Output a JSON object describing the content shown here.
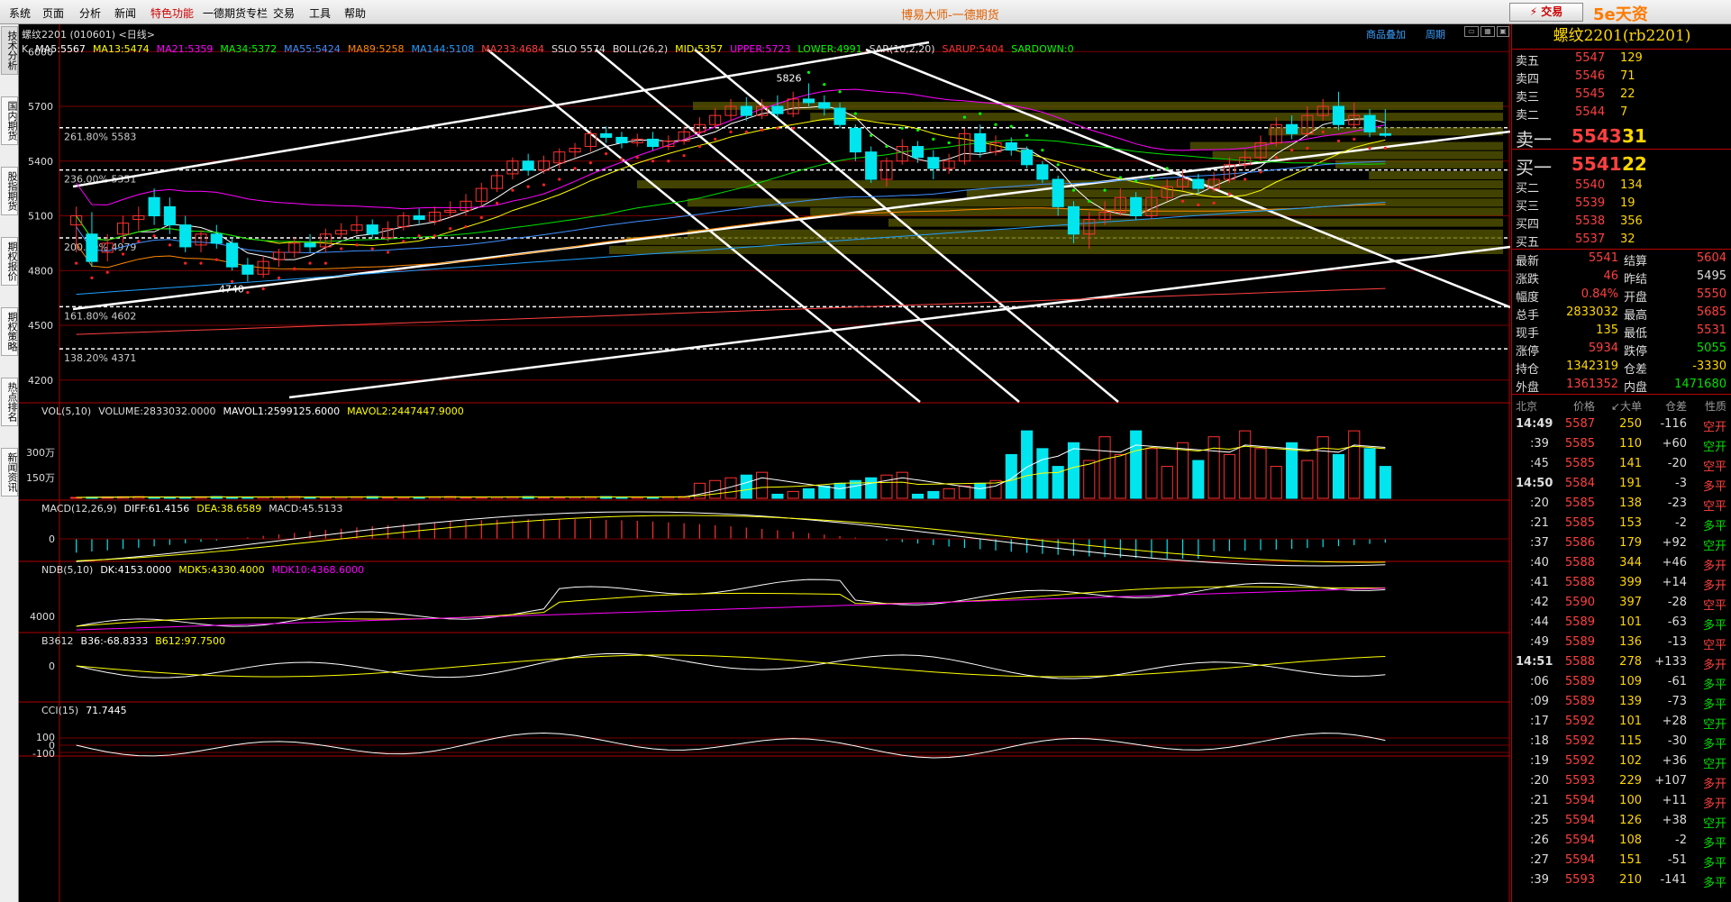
{
  "menu": [
    "系统",
    "页面",
    "分析",
    "新闻",
    "特色功能",
    "一德期货专栏",
    "交易",
    "工具",
    "帮助"
  ],
  "menu_red_index": 4,
  "app_title": "博易大师-一德期货",
  "trade_button": "⚡ 交易",
  "watermark": "5e天资5etz.com",
  "side_tabs": [
    "技术分析",
    "国内期货",
    "股指期货",
    "期权报价",
    "期权策略",
    "热点排名",
    "新闻资讯"
  ],
  "header": {
    "symbol_line": "螺纹2201 (010601) <日线>",
    "link_overlay": "商品叠加",
    "link_period": "周期",
    "k_label": "K",
    "indicators": [
      {
        "text": "MA5:5567",
        "color": "#ffffff"
      },
      {
        "text": "MA13:5474",
        "color": "#ffff00"
      },
      {
        "text": "MA21:5359",
        "color": "#ff00ff"
      },
      {
        "text": "MA34:5372",
        "color": "#00ff00"
      },
      {
        "text": "MA55:5424",
        "color": "#4090ff"
      },
      {
        "text": "MA89:5258",
        "color": "#ff8800"
      },
      {
        "text": "MA144:5108",
        "color": "#20a0ff"
      },
      {
        "text": "MA233:4684",
        "color": "#ff4040"
      },
      {
        "text": "SSLO 5574",
        "color": "#dddddd"
      },
      {
        "text": "BOLL(26,2)",
        "color": "#dddddd"
      },
      {
        "text": "MID:5357",
        "color": "#ffff00"
      },
      {
        "text": "UPPER:5723",
        "color": "#ff00ff"
      },
      {
        "text": "LOWER:4991",
        "color": "#00ff00"
      },
      {
        "text": "SAR(10,2,20)",
        "color": "#dddddd"
      },
      {
        "text": "SARUP:5404",
        "color": "#ff3030"
      },
      {
        "text": "SARDOWN:0",
        "color": "#00ff00"
      }
    ]
  },
  "price_axis": [
    "6000",
    "5700",
    "5400",
    "5100",
    "4800",
    "4500",
    "4200"
  ],
  "fib_labels": [
    "261.80% 5583",
    "236.00% 5351",
    "200.00% 4979",
    "161.80% 4602",
    "138.20% 4371"
  ],
  "price_marks": {
    "high": "5826",
    "low": "4740"
  },
  "volume_panel": {
    "title": "VOL(5,10)",
    "items": [
      {
        "text": "VOLUME:2833032.0000",
        "color": "#dddddd"
      },
      {
        "text": "MAVOL1:2599125.6000",
        "color": "#ffffff"
      },
      {
        "text": "MAVOL2:2447447.9000",
        "color": "#ffff00"
      }
    ],
    "axis": [
      "300万",
      "150万"
    ]
  },
  "macd_panel": {
    "title": "MACD(12,26,9)",
    "items": [
      {
        "text": "DIFF:61.4156",
        "color": "#ffffff"
      },
      {
        "text": "DEA:38.6589",
        "color": "#ffff00"
      },
      {
        "text": "MACD:45.5133",
        "color": "#dddddd"
      }
    ],
    "axis": [
      "0"
    ]
  },
  "ndb_panel": {
    "title": "NDB(5,10)",
    "items": [
      {
        "text": "DK:4153.0000",
        "color": "#ffffff"
      },
      {
        "text": "MDK5:4330.4000",
        "color": "#ffff00"
      },
      {
        "text": "MDK10:4368.6000",
        "color": "#ff00ff"
      }
    ],
    "axis": [
      "4000"
    ]
  },
  "b3612_panel": {
    "title": "B3612",
    "items": [
      {
        "text": "B36:-68.8333",
        "color": "#ffffff"
      },
      {
        "text": "B612:97.7500",
        "color": "#ffff00"
      }
    ],
    "axis": [
      "0"
    ]
  },
  "cci_panel": {
    "title": "CCI(15)",
    "items": [
      {
        "text": "71.7445",
        "color": "#ffffff"
      }
    ],
    "axis": [
      "100",
      "0",
      "-100"
    ]
  },
  "quote": {
    "title": "螺纹2201(rb2201)",
    "asks": [
      {
        "label": "卖五",
        "price": "5547",
        "vol": "129"
      },
      {
        "label": "卖四",
        "price": "5546",
        "vol": "71"
      },
      {
        "label": "卖三",
        "price": "5545",
        "vol": "22"
      },
      {
        "label": "卖二",
        "price": "5544",
        "vol": "7"
      },
      {
        "label": "卖一",
        "price": "5543",
        "vol": "31"
      }
    ],
    "bids": [
      {
        "label": "买一",
        "price": "5541",
        "vol": "22"
      },
      {
        "label": "买二",
        "price": "5540",
        "vol": "134"
      },
      {
        "label": "买三",
        "price": "5539",
        "vol": "19"
      },
      {
        "label": "买四",
        "price": "5538",
        "vol": "356"
      },
      {
        "label": "买五",
        "price": "5537",
        "vol": "32"
      }
    ],
    "stats": [
      {
        "l1": "最新",
        "v1": "5541",
        "c1": "red",
        "l2": "结算",
        "v2": "5604",
        "c2": "red"
      },
      {
        "l1": "涨跌",
        "v1": "46",
        "c1": "red",
        "l2": "昨结",
        "v2": "5495",
        "c2": "white"
      },
      {
        "l1": "幅度",
        "v1": "0.84%",
        "c1": "red",
        "l2": "开盘",
        "v2": "5550",
        "c2": "red"
      },
      {
        "l1": "总手",
        "v1": "2833032",
        "c1": "yellow",
        "l2": "最高",
        "v2": "5685",
        "c2": "red"
      },
      {
        "l1": "现手",
        "v1": "135",
        "c1": "yellow",
        "l2": "最低",
        "v2": "5531",
        "c2": "red"
      },
      {
        "l1": "涨停",
        "v1": "5934",
        "c1": "red",
        "l2": "跌停",
        "v2": "5055",
        "c2": "green"
      },
      {
        "l1": "持仓",
        "v1": "1342319",
        "c1": "yellow",
        "l2": "仓差",
        "v2": "-3330",
        "c2": "yellow"
      },
      {
        "l1": "外盘",
        "v1": "1361352",
        "c1": "red",
        "l2": "内盘",
        "v2": "1471680",
        "c2": "green"
      }
    ],
    "trade_header": [
      "北京",
      "价格",
      "↙大单",
      "仓差",
      "性质"
    ],
    "trades": [
      {
        "t": "14:49",
        "p": "5587",
        "v": "250",
        "d": "-116",
        "n": "空开",
        "nc": "red",
        "main": true
      },
      {
        "t": ":39",
        "p": "5585",
        "v": "110",
        "d": "+60",
        "n": "空开",
        "nc": "green"
      },
      {
        "t": ":45",
        "p": "5585",
        "v": "141",
        "d": "-20",
        "n": "空平",
        "nc": "red"
      },
      {
        "t": "14:50",
        "p": "5584",
        "v": "191",
        "d": "-3",
        "n": "多平",
        "nc": "red",
        "main": true
      },
      {
        "t": ":20",
        "p": "5585",
        "v": "138",
        "d": "-23",
        "n": "空平",
        "nc": "red"
      },
      {
        "t": ":21",
        "p": "5585",
        "v": "153",
        "d": "-2",
        "n": "多平",
        "nc": "green"
      },
      {
        "t": ":37",
        "p": "5586",
        "v": "179",
        "d": "+92",
        "n": "空开",
        "nc": "green"
      },
      {
        "t": ":40",
        "p": "5588",
        "v": "344",
        "d": "+46",
        "n": "多开",
        "nc": "red"
      },
      {
        "t": ":41",
        "p": "5588",
        "v": "399",
        "d": "+14",
        "n": "多开",
        "nc": "red"
      },
      {
        "t": ":42",
        "p": "5590",
        "v": "397",
        "d": "-28",
        "n": "空平",
        "nc": "red"
      },
      {
        "t": ":44",
        "p": "5589",
        "v": "101",
        "d": "-63",
        "n": "多平",
        "nc": "green"
      },
      {
        "t": ":49",
        "p": "5589",
        "v": "136",
        "d": "-13",
        "n": "空平",
        "nc": "red"
      },
      {
        "t": "14:51",
        "p": "5588",
        "v": "278",
        "d": "+133",
        "n": "多开",
        "nc": "red",
        "main": true
      },
      {
        "t": ":06",
        "p": "5589",
        "v": "109",
        "d": "-61",
        "n": "多平",
        "nc": "green"
      },
      {
        "t": ":09",
        "p": "5589",
        "v": "139",
        "d": "-73",
        "n": "多平",
        "nc": "green"
      },
      {
        "t": ":17",
        "p": "5592",
        "v": "101",
        "d": "+28",
        "n": "空开",
        "nc": "green"
      },
      {
        "t": ":18",
        "p": "5592",
        "v": "115",
        "d": "-30",
        "n": "多平",
        "nc": "green"
      },
      {
        "t": ":19",
        "p": "5592",
        "v": "102",
        "d": "+36",
        "n": "空开",
        "nc": "green"
      },
      {
        "t": ":20",
        "p": "5593",
        "v": "229",
        "d": "+107",
        "n": "多开",
        "nc": "red"
      },
      {
        "t": ":21",
        "p": "5594",
        "v": "100",
        "d": "+11",
        "n": "多开",
        "nc": "red"
      },
      {
        "t": ":25",
        "p": "5594",
        "v": "126",
        "d": "+38",
        "n": "空开",
        "nc": "green"
      },
      {
        "t": ":26",
        "p": "5594",
        "v": "108",
        "d": "-2",
        "n": "多平",
        "nc": "green"
      },
      {
        "t": ":27",
        "p": "5594",
        "v": "151",
        "d": "-51",
        "n": "多平",
        "nc": "green"
      },
      {
        "t": ":39",
        "p": "5593",
        "v": "210",
        "d": "-141",
        "n": "多平",
        "nc": "green"
      }
    ]
  },
  "chart_data": {
    "type": "candlestick",
    "symbol": "rb2201",
    "period": "日线",
    "ylim": [
      4100,
      6100
    ],
    "candles": [
      [
        5050,
        5100,
        5150,
        4900
      ],
      [
        5000,
        4850,
        5120,
        4820
      ],
      [
        4900,
        4950,
        5000,
        4850
      ],
      [
        5000,
        5060,
        5100,
        4950
      ],
      [
        5080,
        5100,
        5150,
        5020
      ],
      [
        5200,
        5100,
        5250,
        5050
      ],
      [
        5150,
        5050,
        5200,
        5000
      ],
      [
        5050,
        4930,
        5100,
        4900
      ],
      [
        4940,
        5000,
        5020,
        4900
      ],
      [
        5000,
        4950,
        5050,
        4920
      ],
      [
        4950,
        4820,
        4980,
        4800
      ],
      [
        4830,
        4780,
        4870,
        4740
      ],
      [
        4780,
        4850,
        4880,
        4760
      ],
      [
        4860,
        4900,
        4920,
        4820
      ],
      [
        4900,
        4950,
        4980,
        4870
      ],
      [
        4950,
        4930,
        5000,
        4900
      ],
      [
        4930,
        5000,
        5030,
        4900
      ],
      [
        5000,
        5020,
        5060,
        4980
      ],
      [
        5020,
        5050,
        5100,
        5000
      ],
      [
        5050,
        5000,
        5080,
        4980
      ],
      [
        4980,
        5030,
        5070,
        4960
      ],
      [
        5040,
        5100,
        5120,
        5020
      ],
      [
        5100,
        5080,
        5140,
        5050
      ],
      [
        5070,
        5120,
        5150,
        5050
      ],
      [
        5120,
        5130,
        5180,
        5090
      ],
      [
        5130,
        5180,
        5220,
        5100
      ],
      [
        5180,
        5250,
        5280,
        5150
      ],
      [
        5250,
        5320,
        5350,
        5230
      ],
      [
        5330,
        5400,
        5420,
        5300
      ],
      [
        5400,
        5350,
        5440,
        5320
      ],
      [
        5350,
        5400,
        5430,
        5330
      ],
      [
        5390,
        5450,
        5470,
        5360
      ],
      [
        5450,
        5470,
        5500,
        5420
      ],
      [
        5480,
        5550,
        5570,
        5450
      ],
      [
        5550,
        5530,
        5590,
        5500
      ],
      [
        5530,
        5500,
        5560,
        5470
      ],
      [
        5500,
        5520,
        5550,
        5480
      ],
      [
        5520,
        5480,
        5560,
        5460
      ],
      [
        5480,
        5510,
        5540,
        5460
      ],
      [
        5510,
        5560,
        5590,
        5490
      ],
      [
        5560,
        5600,
        5640,
        5540
      ],
      [
        5600,
        5650,
        5690,
        5580
      ],
      [
        5650,
        5700,
        5740,
        5620
      ],
      [
        5700,
        5650,
        5750,
        5620
      ],
      [
        5650,
        5700,
        5740,
        5630
      ],
      [
        5700,
        5660,
        5760,
        5640
      ],
      [
        5660,
        5740,
        5780,
        5640
      ],
      [
        5740,
        5720,
        5826,
        5700
      ],
      [
        5720,
        5690,
        5760,
        5650
      ],
      [
        5690,
        5600,
        5720,
        5580
      ],
      [
        5580,
        5450,
        5600,
        5400
      ],
      [
        5450,
        5300,
        5480,
        5280
      ],
      [
        5300,
        5400,
        5420,
        5260
      ],
      [
        5400,
        5480,
        5520,
        5380
      ],
      [
        5480,
        5420,
        5510,
        5390
      ],
      [
        5420,
        5360,
        5460,
        5300
      ],
      [
        5360,
        5400,
        5440,
        5330
      ],
      [
        5400,
        5550,
        5580,
        5380
      ],
      [
        5550,
        5450,
        5600,
        5420
      ],
      [
        5450,
        5500,
        5540,
        5430
      ],
      [
        5500,
        5460,
        5530,
        5430
      ],
      [
        5460,
        5380,
        5480,
        5360
      ],
      [
        5380,
        5300,
        5400,
        5280
      ],
      [
        5300,
        5150,
        5320,
        5100
      ],
      [
        5150,
        5000,
        5180,
        4950
      ],
      [
        5000,
        5080,
        5120,
        4920
      ],
      [
        5080,
        5120,
        5180,
        5050
      ],
      [
        5120,
        5200,
        5250,
        5100
      ],
      [
        5200,
        5100,
        5230,
        5080
      ],
      [
        5100,
        5200,
        5250,
        5080
      ],
      [
        5200,
        5260,
        5300,
        5180
      ],
      [
        5260,
        5300,
        5350,
        5240
      ],
      [
        5300,
        5250,
        5330,
        5220
      ],
      [
        5250,
        5300,
        5340,
        5230
      ],
      [
        5300,
        5380,
        5420,
        5280
      ],
      [
        5380,
        5420,
        5460,
        5360
      ],
      [
        5420,
        5500,
        5540,
        5400
      ],
      [
        5500,
        5600,
        5640,
        5480
      ],
      [
        5600,
        5550,
        5650,
        5520
      ],
      [
        5550,
        5650,
        5700,
        5530
      ],
      [
        5650,
        5700,
        5740,
        5620
      ],
      [
        5700,
        5600,
        5780,
        5570
      ],
      [
        5600,
        5650,
        5720,
        5580
      ],
      [
        5650,
        5560,
        5685,
        5531
      ],
      [
        5550,
        5541,
        5685,
        5531
      ]
    ]
  }
}
